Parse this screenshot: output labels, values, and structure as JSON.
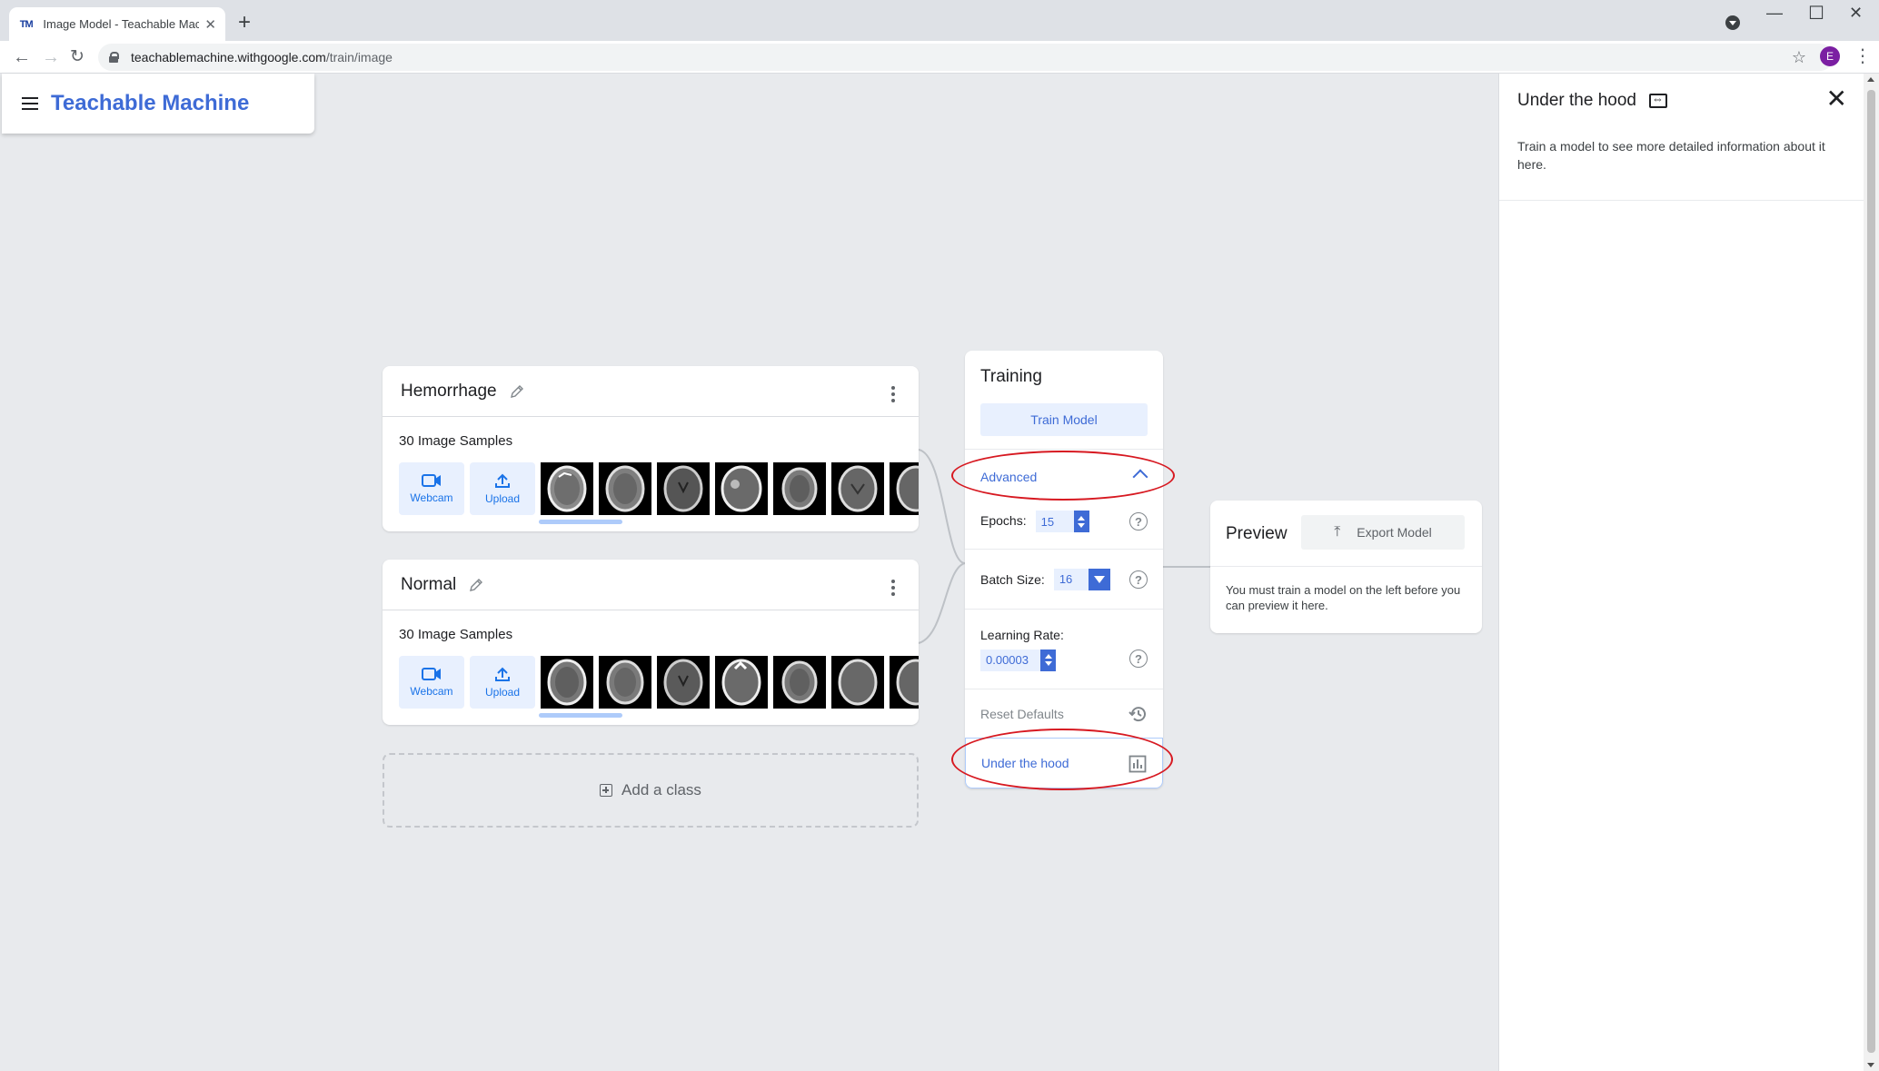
{
  "browser": {
    "tab_title": "Image Model - Teachable Machi",
    "favicon_text": "TM",
    "url_host": "teachablemachine.withgoogle.com",
    "url_path": "/train/image",
    "profile_initial": "E"
  },
  "app": {
    "brand": "Teachable Machine"
  },
  "classes": [
    {
      "name": "Hemorrhage",
      "samples_label": "30 Image Samples",
      "webcam_label": "Webcam",
      "upload_label": "Upload"
    },
    {
      "name": "Normal",
      "samples_label": "30 Image Samples",
      "webcam_label": "Webcam",
      "upload_label": "Upload"
    }
  ],
  "add_class_label": "Add a class",
  "training": {
    "title": "Training",
    "train_button": "Train Model",
    "advanced_label": "Advanced",
    "epochs_label": "Epochs:",
    "epochs_value": "15",
    "batch_size_label": "Batch Size:",
    "batch_size_value": "16",
    "learning_rate_label": "Learning Rate:",
    "learning_rate_value": "0.00003",
    "help_glyph": "?",
    "reset_label": "Reset Defaults",
    "under_hood_label": "Under the hood"
  },
  "preview": {
    "title": "Preview",
    "export_label": "Export Model",
    "message": "You must train a model on the left before you can preview it here."
  },
  "side_panel": {
    "title": "Under the hood",
    "message": "Train a model to see more detailed information about it here."
  },
  "colors": {
    "accent": "#3e6bd6",
    "annotation": "#d71921",
    "button_bg": "#e8f0fe"
  }
}
